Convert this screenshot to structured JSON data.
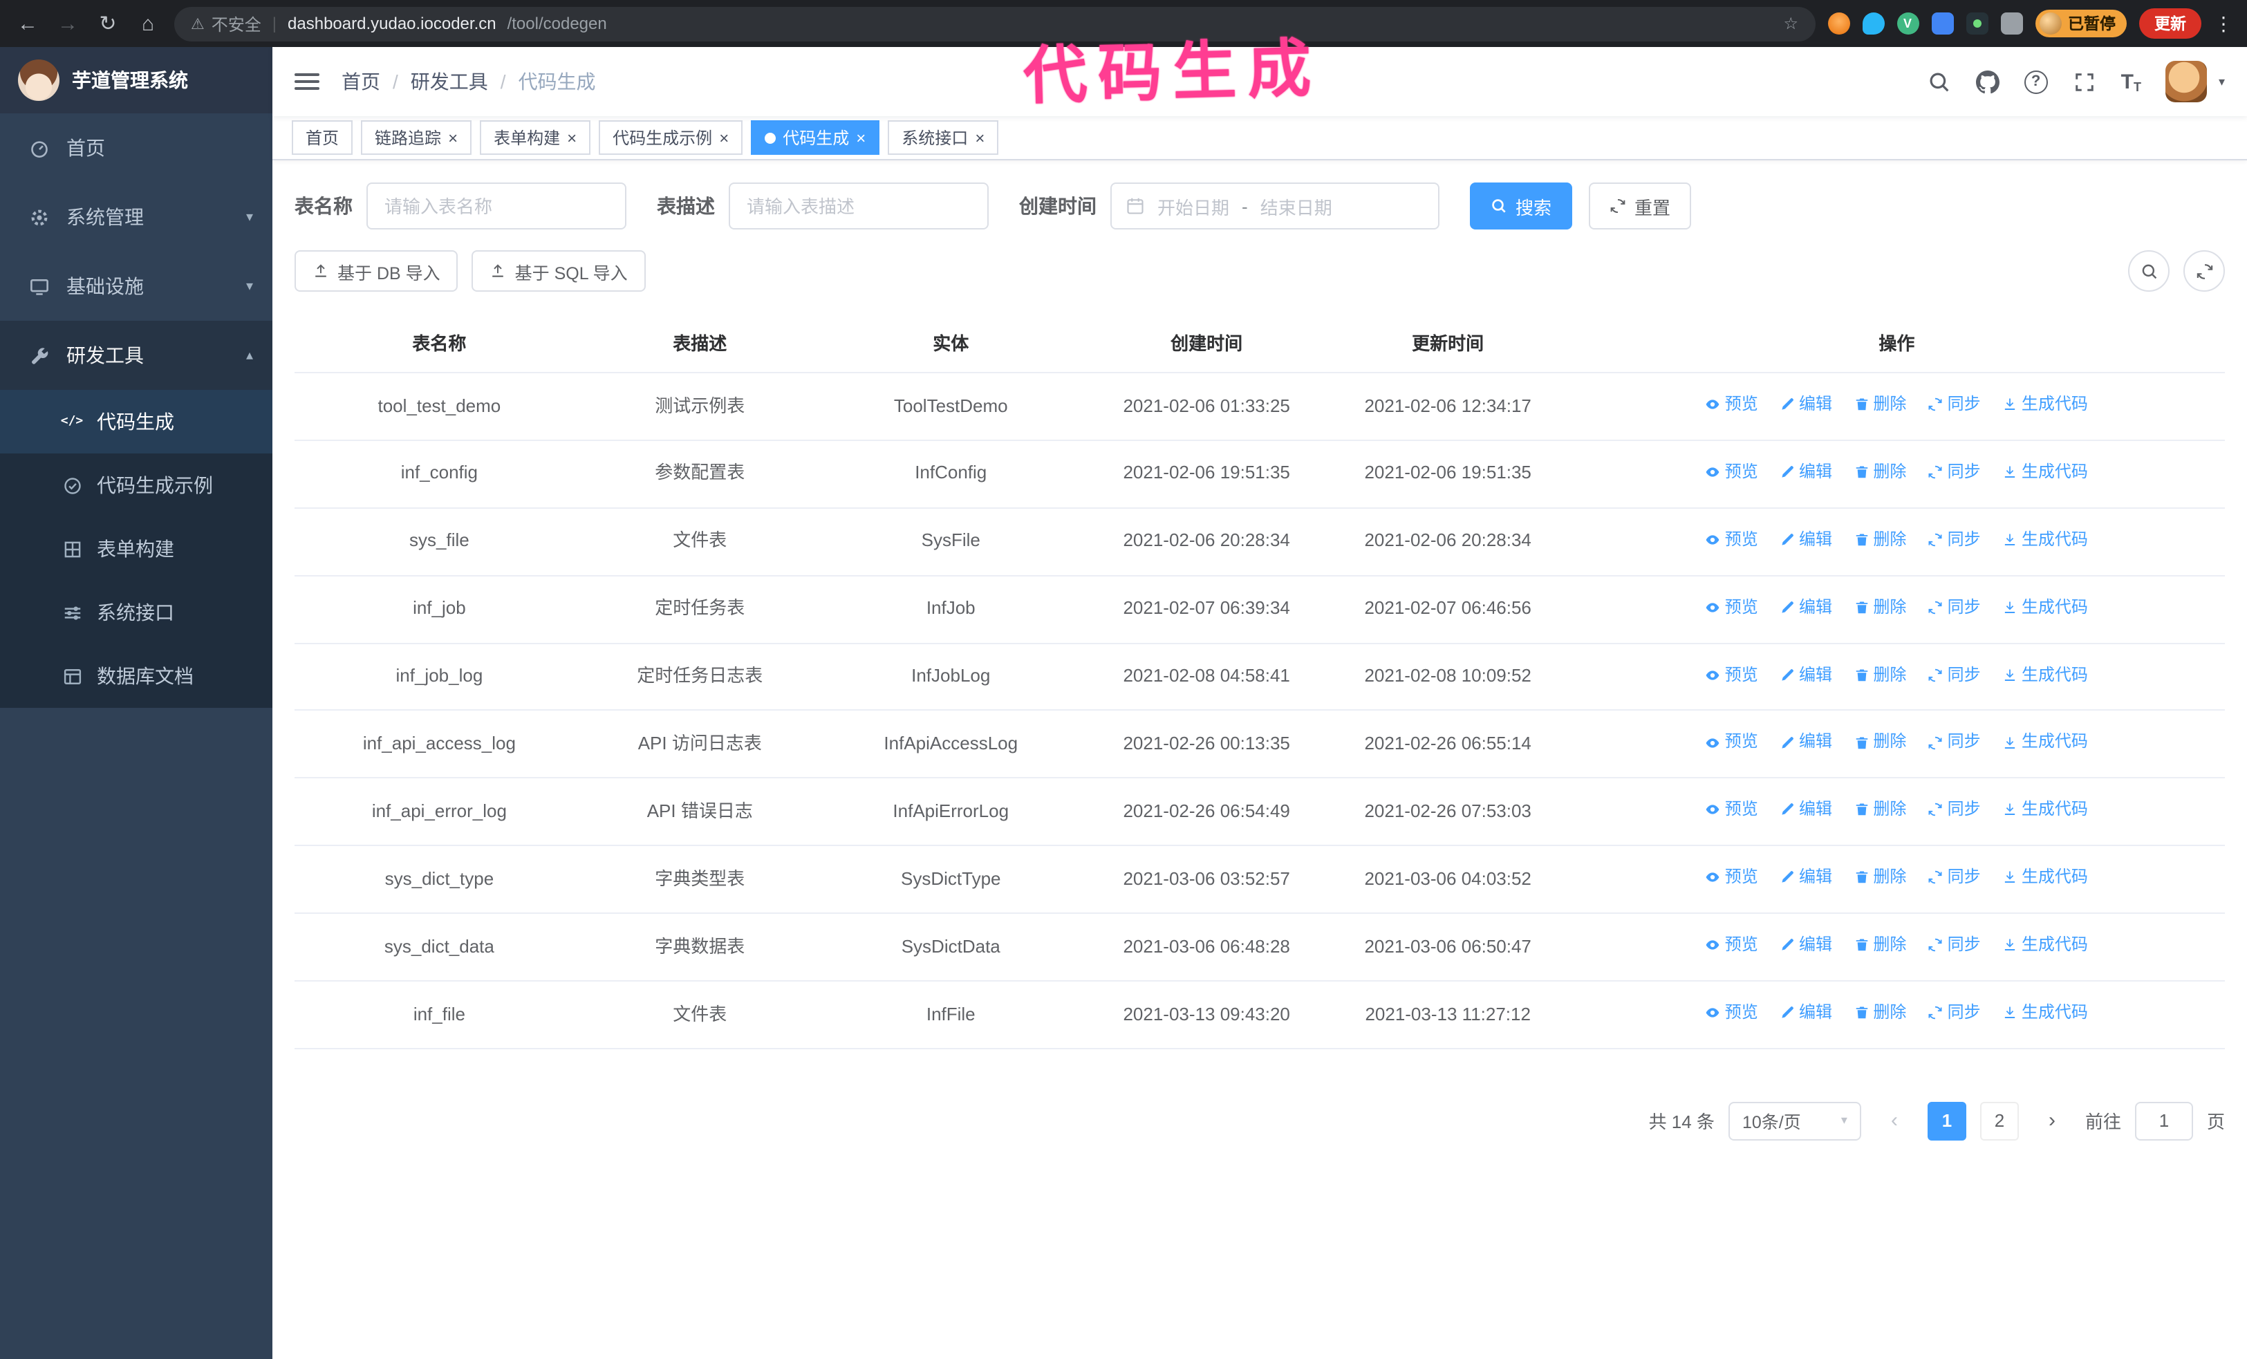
{
  "colors": {
    "accent": "#409eff",
    "sidebar_bg": "#304156",
    "submenu_bg": "#1f2d3d",
    "active_tab": "#409eff",
    "update_red": "#d93025",
    "paused_orange": "#f2a33c",
    "annotation_pink": "#ff3d92"
  },
  "annotation": "代码生成",
  "browser": {
    "security_label": "不安全",
    "url_host": "dashboard.yudao.iocoder.cn",
    "url_path": "/tool/codegen",
    "profile_chip": "已暂停",
    "update_button": "更新"
  },
  "sidebar": {
    "logo_title": "芋道管理系统",
    "menu": [
      {
        "label": "首页"
      },
      {
        "label": "系统管理",
        "expandable": true
      },
      {
        "label": "基础设施",
        "expandable": true
      },
      {
        "label": "研发工具",
        "expandable": true,
        "expanded": true
      }
    ],
    "submenu": [
      {
        "label": "代码生成",
        "active": true
      },
      {
        "label": "代码生成示例"
      },
      {
        "label": "表单构建"
      },
      {
        "label": "系统接口"
      },
      {
        "label": "数据库文档"
      }
    ]
  },
  "header": {
    "breadcrumb": [
      "首页",
      "研发工具",
      "代码生成"
    ]
  },
  "tabs": [
    {
      "label": "首页",
      "closable": false
    },
    {
      "label": "链路追踪",
      "closable": true
    },
    {
      "label": "表单构建",
      "closable": true
    },
    {
      "label": "代码生成示例",
      "closable": true
    },
    {
      "label": "代码生成",
      "closable": true,
      "active": true
    },
    {
      "label": "系统接口",
      "closable": true
    }
  ],
  "filters": {
    "table_name_label": "表名称",
    "table_name_placeholder": "请输入表名称",
    "table_desc_label": "表描述",
    "table_desc_placeholder": "请输入表描述",
    "create_time_label": "创建时间",
    "date_start_placeholder": "开始日期",
    "date_separator": "-",
    "date_end_placeholder": "结束日期",
    "search_button": "搜索",
    "reset_button": "重置"
  },
  "toolbar": {
    "import_db": "基于 DB 导入",
    "import_sql": "基于 SQL 导入"
  },
  "table": {
    "columns": [
      "表名称",
      "表描述",
      "实体",
      "创建时间",
      "更新时间",
      "操作"
    ],
    "actions": [
      "预览",
      "编辑",
      "删除",
      "同步",
      "生成代码"
    ],
    "rows": [
      {
        "name": "tool_test_demo",
        "desc": "测试示例表",
        "entity": "ToolTestDemo",
        "created": "2021-02-06 01:33:25",
        "updated": "2021-02-06 12:34:17"
      },
      {
        "name": "inf_config",
        "desc": "参数配置表",
        "entity": "InfConfig",
        "created": "2021-02-06 19:51:35",
        "updated": "2021-02-06 19:51:35"
      },
      {
        "name": "sys_file",
        "desc": "文件表",
        "entity": "SysFile",
        "created": "2021-02-06 20:28:34",
        "updated": "2021-02-06 20:28:34"
      },
      {
        "name": "inf_job",
        "desc": "定时任务表",
        "entity": "InfJob",
        "created": "2021-02-07 06:39:34",
        "updated": "2021-02-07 06:46:56"
      },
      {
        "name": "inf_job_log",
        "desc": "定时任务日志表",
        "entity": "InfJobLog",
        "created": "2021-02-08 04:58:41",
        "updated": "2021-02-08 10:09:52"
      },
      {
        "name": "inf_api_access_log",
        "desc": "API 访问日志表",
        "entity": "InfApiAccessLog",
        "created": "2021-02-26 00:13:35",
        "updated": "2021-02-26 06:55:14"
      },
      {
        "name": "inf_api_error_log",
        "desc": "API 错误日志",
        "entity": "InfApiErrorLog",
        "created": "2021-02-26 06:54:49",
        "updated": "2021-02-26 07:53:03"
      },
      {
        "name": "sys_dict_type",
        "desc": "字典类型表",
        "entity": "SysDictType",
        "created": "2021-03-06 03:52:57",
        "updated": "2021-03-06 04:03:52"
      },
      {
        "name": "sys_dict_data",
        "desc": "字典数据表",
        "entity": "SysDictData",
        "created": "2021-03-06 06:48:28",
        "updated": "2021-03-06 06:50:47"
      },
      {
        "name": "inf_file",
        "desc": "文件表",
        "entity": "InfFile",
        "created": "2021-03-13 09:43:20",
        "updated": "2021-03-13 11:27:12"
      }
    ]
  },
  "pagination": {
    "total": "共 14 条",
    "page_size": "10条/页",
    "pages": [
      "1",
      "2"
    ],
    "goto_label": "前往",
    "goto_value": "1",
    "goto_suffix": "页"
  }
}
